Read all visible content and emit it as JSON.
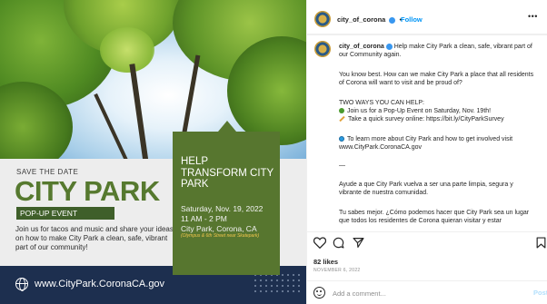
{
  "image": {
    "save_the_date": "SAVE THE DATE",
    "headline": "CITY PARK",
    "popup_label": "POP-UP EVENT",
    "invite_text": "Join us for tacos and music and share your ideas on how to make City Park a clean, safe, vibrant part of our community!",
    "help_title": "HELP TRANSFORM CITY PARK",
    "event_date": "Saturday, Nov. 19, 2022",
    "event_time": "11 AM - 2 PM",
    "event_location": "City Park, Corona, CA",
    "event_note": "(Olympus & 6th Street near Skatepark)",
    "website": "www.CityPark.CoronaCA.gov"
  },
  "header": {
    "username": "city_of_corona",
    "separator": "•",
    "follow_label": "Follow",
    "more_label": "•••"
  },
  "caption": {
    "username": "city_of_corona",
    "line1": "Help make City Park a clean, safe, vibrant part of our Community again.",
    "para2": "You know best. How can we make City Park a place that all residents of Corona will want to visit and be proud of?",
    "ways_title": "TWO WAYS YOU CAN HELP:",
    "way1": "Join us for a Pop-Up Event on Saturday, Nov. 19th!",
    "way2": "Take a quick survey online: https://bit.ly/CityParkSurvey",
    "learn_more": "To learn more about City Park and how to get involved visit www.CityPark.CoronaCA.gov",
    "divider": "—",
    "spanish1": "Ayude a que City Park vuelva a ser una parte limpia, segura y vibrante de nuestra comunidad.",
    "spanish2": "Tu sabes mejor. ¿Cómo podemos hacer que City Park sea un lugar que todos los residentes de Corona quieran visitar y estar"
  },
  "footer": {
    "likes": "82 likes",
    "date": "NOVEMBER 6, 2022",
    "comment_placeholder": "Add a comment...",
    "post_label": "Post"
  },
  "icons": [
    "heart-icon",
    "comment-icon",
    "share-icon",
    "bookmark-icon",
    "emoji-icon",
    "globe-icon",
    "more-icon",
    "verified-badge-icon"
  ],
  "colors": {
    "brand_green": "#56792f",
    "dark_green": "#3f5f2a",
    "navy": "#1d2f4f",
    "link_blue": "#0095f6",
    "event_note_gold": "#f2c64e"
  }
}
